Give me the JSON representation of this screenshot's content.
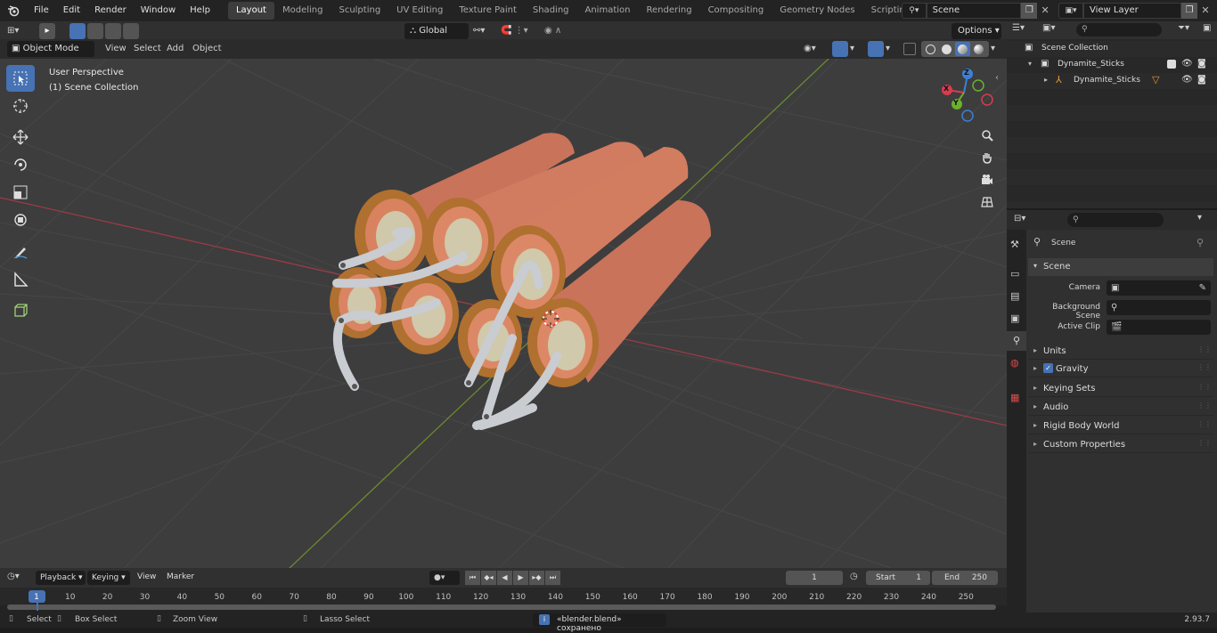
{
  "topbar": {
    "menu": [
      "File",
      "Edit",
      "Render",
      "Window",
      "Help"
    ],
    "workspaces": [
      "Layout",
      "Modeling",
      "Sculpting",
      "UV Editing",
      "Texture Paint",
      "Shading",
      "Animation",
      "Rendering",
      "Compositing",
      "Geometry Nodes",
      "Scripting"
    ],
    "active_workspace": "Layout",
    "scene_name": "Scene",
    "view_layer": "View Layer"
  },
  "viewport_header": {
    "mode": "Object Mode",
    "menus": [
      "View",
      "Select",
      "Add",
      "Object"
    ],
    "orientation": "Global",
    "options": "Options"
  },
  "viewport": {
    "perspective": "User Perspective",
    "collection": "(1) Scene Collection",
    "gizmo": {
      "x": "X",
      "y": "Y",
      "z": "Z"
    }
  },
  "outliner": {
    "root": "Scene Collection",
    "items": [
      {
        "label": "Dynamite_Sticks"
      },
      {
        "label": "Dynamite_Sticks"
      }
    ]
  },
  "properties": {
    "context": "Scene",
    "section": "Scene",
    "fields": [
      {
        "label": "Camera"
      },
      {
        "label": "Background Scene"
      },
      {
        "label": "Active Clip"
      }
    ],
    "panels": [
      "Units",
      "Gravity",
      "Keying Sets",
      "Audio",
      "Rigid Body World",
      "Custom Properties"
    ]
  },
  "timeline": {
    "menus": [
      "Playback",
      "Keying",
      "View",
      "Marker"
    ],
    "current_frame": "1",
    "start_label": "Start",
    "start": "1",
    "end_label": "End",
    "end": "250",
    "ticks": [
      "1",
      "10",
      "20",
      "30",
      "40",
      "50",
      "60",
      "70",
      "80",
      "90",
      "100",
      "110",
      "120",
      "130",
      "140",
      "150",
      "160",
      "170",
      "180",
      "190",
      "200",
      "210",
      "220",
      "230",
      "240",
      "250"
    ]
  },
  "statusbar": {
    "items": [
      "Select",
      "Box Select",
      "Zoom View",
      "Lasso Select"
    ],
    "message": "«blender.blend» сохранено",
    "version": "2.93.7"
  }
}
